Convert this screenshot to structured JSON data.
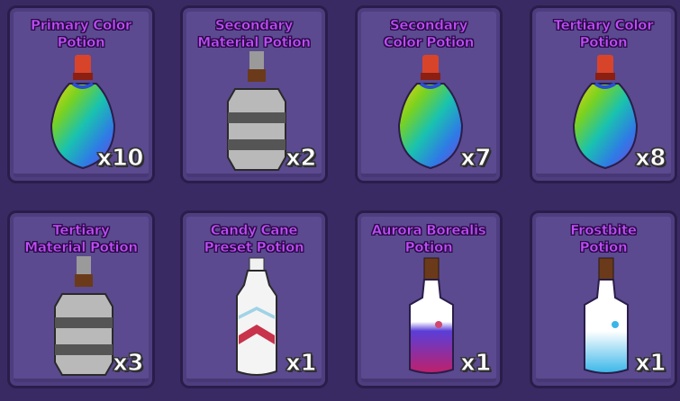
{
  "inventory": {
    "items": [
      {
        "name": "Primary Color\nPotion",
        "qty": "x10",
        "icon": "rainbow-potion-icon"
      },
      {
        "name": "Secondary\nMaterial Potion",
        "qty": "x2",
        "icon": "gray-material-potion-icon"
      },
      {
        "name": "Secondary\nColor Potion",
        "qty": "x7",
        "icon": "rainbow-potion-icon"
      },
      {
        "name": "Tertiary Color\nPotion",
        "qty": "x8",
        "icon": "rainbow-potion-icon"
      },
      {
        "name": "Tertiary\nMaterial Potion",
        "qty": "x3",
        "icon": "gray-material-potion-icon"
      },
      {
        "name": "Candy Cane\nPreset Potion",
        "qty": "x1",
        "icon": "candy-cane-potion-icon"
      },
      {
        "name": "Aurora Borealis\nPotion",
        "qty": "x1",
        "icon": "aurora-potion-icon"
      },
      {
        "name": "Frostbite\nPotion",
        "qty": "x1",
        "icon": "frostbite-potion-icon"
      }
    ]
  },
  "colors": {
    "background": "#3a2a63",
    "card": "#5b4a8f",
    "title": "#c04ef7",
    "quantity": "#ffffff"
  }
}
